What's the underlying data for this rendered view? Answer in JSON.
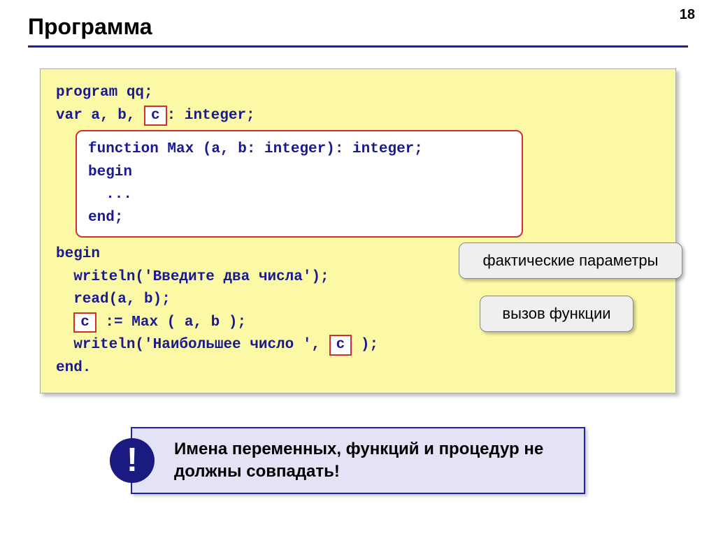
{
  "page_number": "18",
  "title": "Программа",
  "code": {
    "line1": "program qq;",
    "line2a": "var a, b, ",
    "line2_c": "c",
    "line2b": ": integer;",
    "func": {
      "l1": "function Max (a, b: integer): integer;",
      "l2": "begin",
      "l3": "  ...",
      "l4": "end;"
    },
    "line3": "begin",
    "line4": "  writeln('Введите два числа');",
    "line5": "  read(a, b);",
    "line6_c": "c",
    "line6b": " := Max ( a, b );",
    "line7a": "  writeln('Наибольшее число ', ",
    "line7_c": "c",
    "line7b": " );",
    "line8": "end."
  },
  "callouts": {
    "params": "фактические параметры",
    "call": "вызов функции"
  },
  "note": {
    "badge": "!",
    "text": "Имена переменных, функций и процедур не должны совпадать!"
  }
}
